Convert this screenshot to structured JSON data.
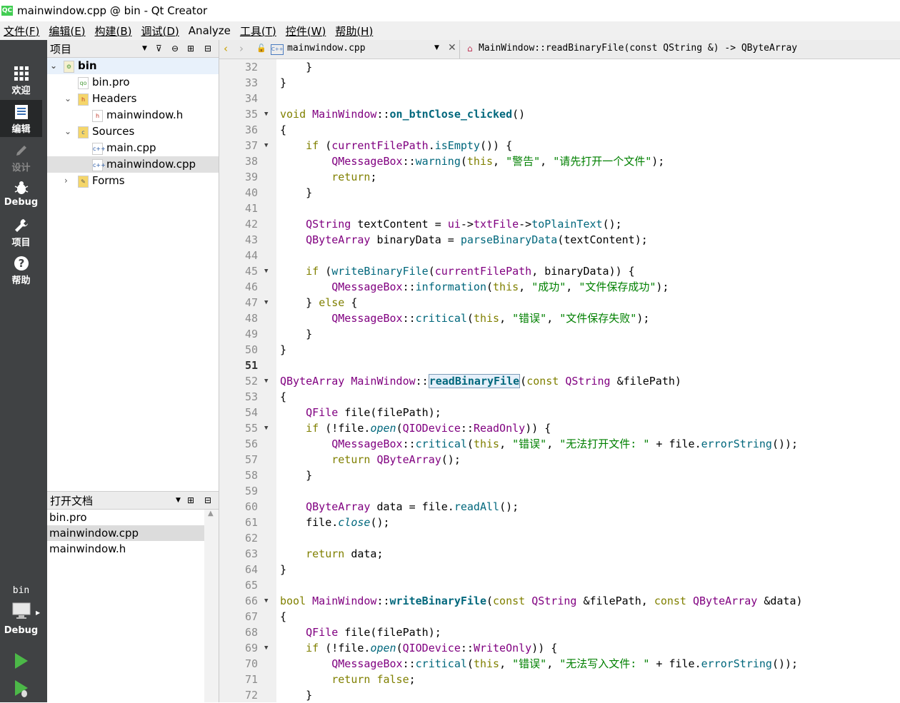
{
  "window": {
    "title": "mainwindow.cpp @ bin - Qt Creator",
    "logo": "QC"
  },
  "menubar": [
    "文件(F)",
    "编辑(E)",
    "构建(B)",
    "调试(D)",
    "Analyze",
    "工具(T)",
    "控件(W)",
    "帮助(H)"
  ],
  "modes": {
    "welcome": "欢迎",
    "edit": "编辑",
    "design": "设计",
    "debug": "Debug",
    "projects": "项目",
    "help": "帮助",
    "target_project": "bin",
    "target_config": "Debug"
  },
  "projects_pane": {
    "title": "项目",
    "tree": [
      {
        "label": "bin",
        "level": 0,
        "expanded": true,
        "kind": "project"
      },
      {
        "label": "bin.pro",
        "level": 1,
        "kind": "pro"
      },
      {
        "label": "Headers",
        "level": 1,
        "expanded": true,
        "kind": "folder-h"
      },
      {
        "label": "mainwindow.h",
        "level": 2,
        "kind": "h"
      },
      {
        "label": "Sources",
        "level": 1,
        "expanded": true,
        "kind": "folder-cpp"
      },
      {
        "label": "main.cpp",
        "level": 2,
        "kind": "cpp"
      },
      {
        "label": "mainwindow.cpp",
        "level": 2,
        "kind": "cpp",
        "selected": true
      },
      {
        "label": "Forms",
        "level": 1,
        "expanded": false,
        "kind": "folder-ui"
      }
    ]
  },
  "open_docs": {
    "title": "打开文档",
    "items": [
      "bin.pro",
      "mainwindow.cpp",
      "mainwindow.h"
    ],
    "selected": 1
  },
  "editor": {
    "file": "mainwindow.cpp",
    "symbol": "MainWindow::readBinaryFile(const QString &) -> QByteArray",
    "current_line": 51,
    "lines": [
      {
        "n": 32,
        "fold": false,
        "html": "    }"
      },
      {
        "n": 33,
        "fold": false,
        "html": "}"
      },
      {
        "n": 34,
        "fold": false,
        "html": ""
      },
      {
        "n": 35,
        "fold": true,
        "html": "<span class='k'>void</span> <span class='ty'>MainWindow</span>::<span class='fnb'>on_btnClose_clicked</span>()"
      },
      {
        "n": 36,
        "fold": false,
        "html": "{"
      },
      {
        "n": 37,
        "fold": true,
        "html": "    <span class='k'>if</span> (<span class='ty'>currentFilePath</span>.<span class='fn'>isEmpty</span>()) {"
      },
      {
        "n": 38,
        "fold": false,
        "html": "        <span class='ty'>QMessageBox</span>::<span class='fn'>warning</span>(<span class='k'>this</span>, <span class='st'>\"警告\"</span>, <span class='st'>\"请先打开一个文件\"</span>);"
      },
      {
        "n": 39,
        "fold": false,
        "html": "        <span class='k'>return</span>;"
      },
      {
        "n": 40,
        "fold": false,
        "html": "    }"
      },
      {
        "n": 41,
        "fold": false,
        "html": ""
      },
      {
        "n": 42,
        "fold": false,
        "html": "    <span class='ty'>QString</span> textContent = <span class='ty'>ui</span>-&gt;<span class='ty'>txtFile</span>-&gt;<span class='fn'>toPlainText</span>();"
      },
      {
        "n": 43,
        "fold": false,
        "html": "    <span class='ty'>QByteArray</span> binaryData = <span class='fn'>parseBinaryData</span>(textContent);"
      },
      {
        "n": 44,
        "fold": false,
        "html": ""
      },
      {
        "n": 45,
        "fold": true,
        "html": "    <span class='k'>if</span> (<span class='fn'>writeBinaryFile</span>(<span class='ty'>currentFilePath</span>, binaryData)) {"
      },
      {
        "n": 46,
        "fold": false,
        "html": "        <span class='ty'>QMessageBox</span>::<span class='fn'>information</span>(<span class='k'>this</span>, <span class='st'>\"成功\"</span>, <span class='st'>\"文件保存成功\"</span>);"
      },
      {
        "n": 47,
        "fold": true,
        "html": "    } <span class='k'>else</span> {"
      },
      {
        "n": 48,
        "fold": false,
        "html": "        <span class='ty'>QMessageBox</span>::<span class='fn'>critical</span>(<span class='k'>this</span>, <span class='st'>\"错误\"</span>, <span class='st'>\"文件保存失败\"</span>);"
      },
      {
        "n": 49,
        "fold": false,
        "html": "    }"
      },
      {
        "n": 50,
        "fold": false,
        "html": "}"
      },
      {
        "n": 51,
        "fold": false,
        "html": ""
      },
      {
        "n": 52,
        "fold": true,
        "html": "<span class='ty'>QByteArray</span> <span class='ty'>MainWindow</span>::<span class='fnb hl'>readBinaryFile</span>(<span class='k'>const</span> <span class='ty'>QString</span> &amp;filePath)"
      },
      {
        "n": 53,
        "fold": false,
        "html": "{"
      },
      {
        "n": 54,
        "fold": false,
        "html": "    <span class='ty'>QFile</span> file(filePath);"
      },
      {
        "n": 55,
        "fold": true,
        "html": "    <span class='k'>if</span> (!file.<span class='it'>open</span>(<span class='ty'>QIODevice</span>::<span class='ty'>ReadOnly</span>)) {"
      },
      {
        "n": 56,
        "fold": false,
        "html": "        <span class='ty'>QMessageBox</span>::<span class='fn'>critical</span>(<span class='k'>this</span>, <span class='st'>\"错误\"</span>, <span class='st'>\"无法打开文件: \"</span> + file.<span class='fn'>errorString</span>());"
      },
      {
        "n": 57,
        "fold": false,
        "html": "        <span class='k'>return</span> <span class='ty'>QByteArray</span>();"
      },
      {
        "n": 58,
        "fold": false,
        "html": "    }"
      },
      {
        "n": 59,
        "fold": false,
        "html": ""
      },
      {
        "n": 60,
        "fold": false,
        "html": "    <span class='ty'>QByteArray</span> data = file.<span class='fn'>readAll</span>();"
      },
      {
        "n": 61,
        "fold": false,
        "html": "    file.<span class='it'>close</span>();"
      },
      {
        "n": 62,
        "fold": false,
        "html": ""
      },
      {
        "n": 63,
        "fold": false,
        "html": "    <span class='k'>return</span> data;"
      },
      {
        "n": 64,
        "fold": false,
        "html": "}"
      },
      {
        "n": 65,
        "fold": false,
        "html": ""
      },
      {
        "n": 66,
        "fold": true,
        "html": "<span class='k'>bool</span> <span class='ty'>MainWindow</span>::<span class='fnb'>writeBinaryFile</span>(<span class='k'>const</span> <span class='ty'>QString</span> &amp;filePath, <span class='k'>const</span> <span class='ty'>QByteArray</span> &amp;data)"
      },
      {
        "n": 67,
        "fold": false,
        "html": "{"
      },
      {
        "n": 68,
        "fold": false,
        "html": "    <span class='ty'>QFile</span> file(filePath);"
      },
      {
        "n": 69,
        "fold": true,
        "html": "    <span class='k'>if</span> (!file.<span class='it'>open</span>(<span class='ty'>QIODevice</span>::<span class='ty'>WriteOnly</span>)) {"
      },
      {
        "n": 70,
        "fold": false,
        "html": "        <span class='ty'>QMessageBox</span>::<span class='fn'>critical</span>(<span class='k'>this</span>, <span class='st'>\"错误\"</span>, <span class='st'>\"无法写入文件: \"</span> + file.<span class='fn'>errorString</span>());"
      },
      {
        "n": 71,
        "fold": false,
        "html": "        <span class='k'>return</span> <span class='k'>false</span>;"
      },
      {
        "n": 72,
        "fold": false,
        "html": "    }"
      }
    ]
  }
}
